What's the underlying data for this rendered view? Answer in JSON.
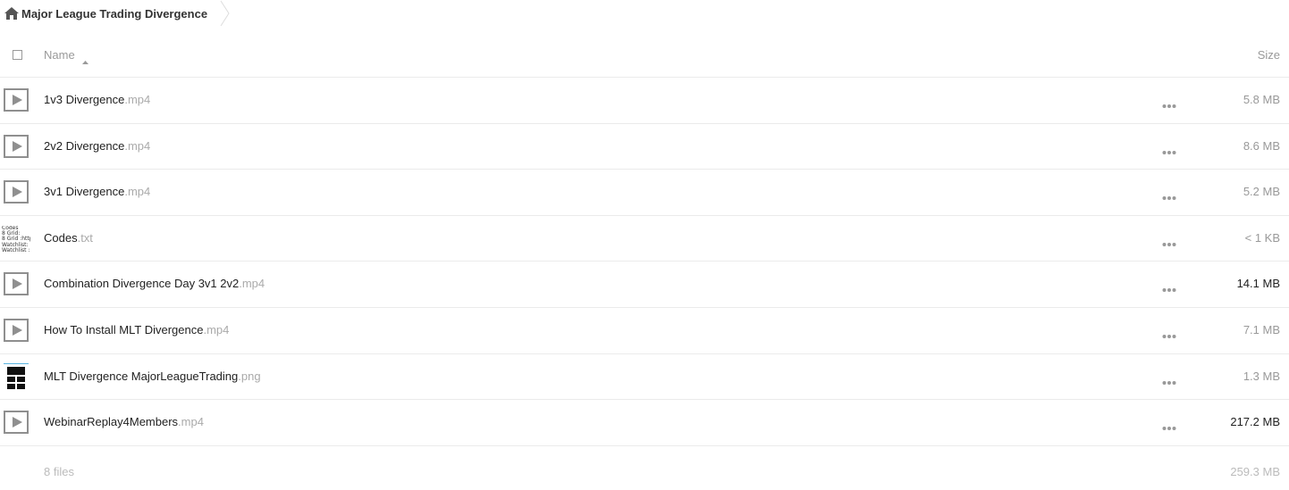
{
  "breadcrumb": {
    "label": "Major League Trading Divergence"
  },
  "header": {
    "name_label": "Name",
    "size_label": "Size"
  },
  "files": [
    {
      "name": "1v3 Divergence",
      "ext": ".mp4",
      "size": "5.8 MB",
      "type": "video",
      "icon": "play-icon"
    },
    {
      "name": "2v2 Divergence",
      "ext": ".mp4",
      "size": "8.6 MB",
      "type": "video",
      "icon": "play-icon"
    },
    {
      "name": "3v1 Divergence",
      "ext": ".mp4",
      "size": "5.2 MB",
      "type": "video",
      "icon": "play-icon"
    },
    {
      "name": "Codes",
      "ext": ".txt",
      "size": "< 1 KB",
      "type": "text",
      "icon": "text-preview",
      "preview_lines": [
        "Codes",
        "8 Grid:",
        "8 Grid :http",
        "Watchlist:",
        "Watchlist :"
      ]
    },
    {
      "name": "Combination Divergence Day 3v1 2v2",
      "ext": ".mp4",
      "size": "14.1 MB",
      "type": "video",
      "icon": "play-icon"
    },
    {
      "name": "How To Install MLT Divergence",
      "ext": ".mp4",
      "size": "7.1 MB",
      "type": "video",
      "icon": "play-icon"
    },
    {
      "name": "MLT Divergence MajorLeagueTrading",
      "ext": ".png",
      "size": "1.3 MB",
      "type": "image",
      "icon": "image-preview"
    },
    {
      "name": "WebinarReplay4Members",
      "ext": ".mp4",
      "size": "217.2 MB",
      "type": "video",
      "icon": "play-icon"
    }
  ],
  "footer": {
    "count": "8 files",
    "total_size": "259.3 MB"
  },
  "colors": {
    "muted": "#999999",
    "ext": "#aaaaaa",
    "border": "#ebebeb",
    "text": "#222222"
  }
}
